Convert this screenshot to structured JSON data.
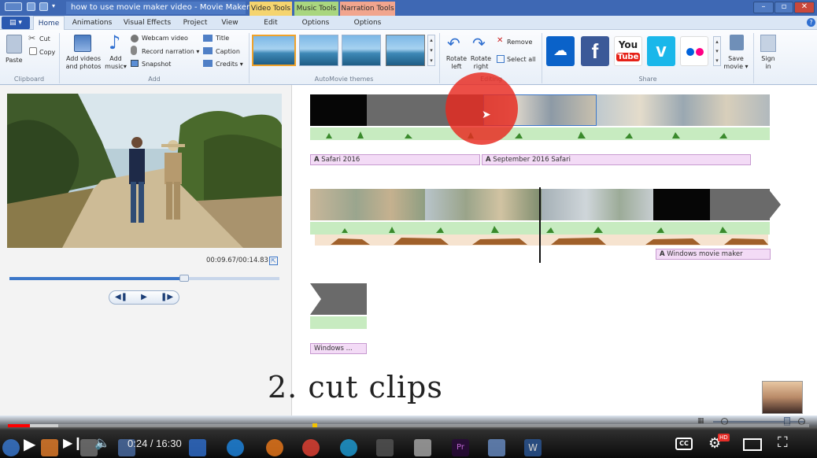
{
  "window": {
    "doc_title": "how to use movie maker video - Movie Maker",
    "context_tabs": [
      "Video Tools",
      "Music Tools",
      "Narration Tools"
    ]
  },
  "tabs": {
    "file": "",
    "items": [
      "Home",
      "Animations",
      "Visual Effects",
      "Project",
      "View",
      "Edit",
      "Options",
      "Options"
    ]
  },
  "ribbon": {
    "clipboard": {
      "paste": "Paste",
      "cut": "Cut",
      "copy": "Copy",
      "group": "Clipboard"
    },
    "add": {
      "add_videos": "Add videos",
      "and_photos": "and photos",
      "add_music": "Add",
      "music": "music",
      "webcam": "Webcam video",
      "record": "Record narration",
      "snapshot": "Snapshot",
      "title": "Title",
      "caption": "Caption",
      "credits": "Credits",
      "group": "Add"
    },
    "autotheme_group": "AutoMovie themes",
    "editing": {
      "rotate_left": "Rotate",
      "rotate_left_2": "left",
      "rotate_right": "Rotate",
      "rotate_right_2": "right",
      "remove": "Remove",
      "select_all": "Select all",
      "group": "Editing"
    },
    "share": {
      "youtube_1": "You",
      "youtube_2": "Tube",
      "save": "Save",
      "save_2": "movie",
      "sign_in": "Sign",
      "sign_in_2": "in",
      "group": "Share"
    }
  },
  "preview": {
    "timecode": "00:09.67/00:14.83",
    "progress": 0.65
  },
  "timeline": {
    "captions": [
      "Safari 2016",
      "September 2016 Safari",
      "Windows movie maker",
      "Windows ..."
    ],
    "overlay_text": "2. cut clips"
  },
  "player": {
    "time": "0:24 / 16:30",
    "progress": 0.024,
    "hd_badge": "HD",
    "cc_label": "CC"
  },
  "colors": {
    "accent": "#3e68b4",
    "highlight": "#e8281e",
    "caption_bg": "#f3dbf6",
    "audio_bg": "#c7ebc0"
  }
}
